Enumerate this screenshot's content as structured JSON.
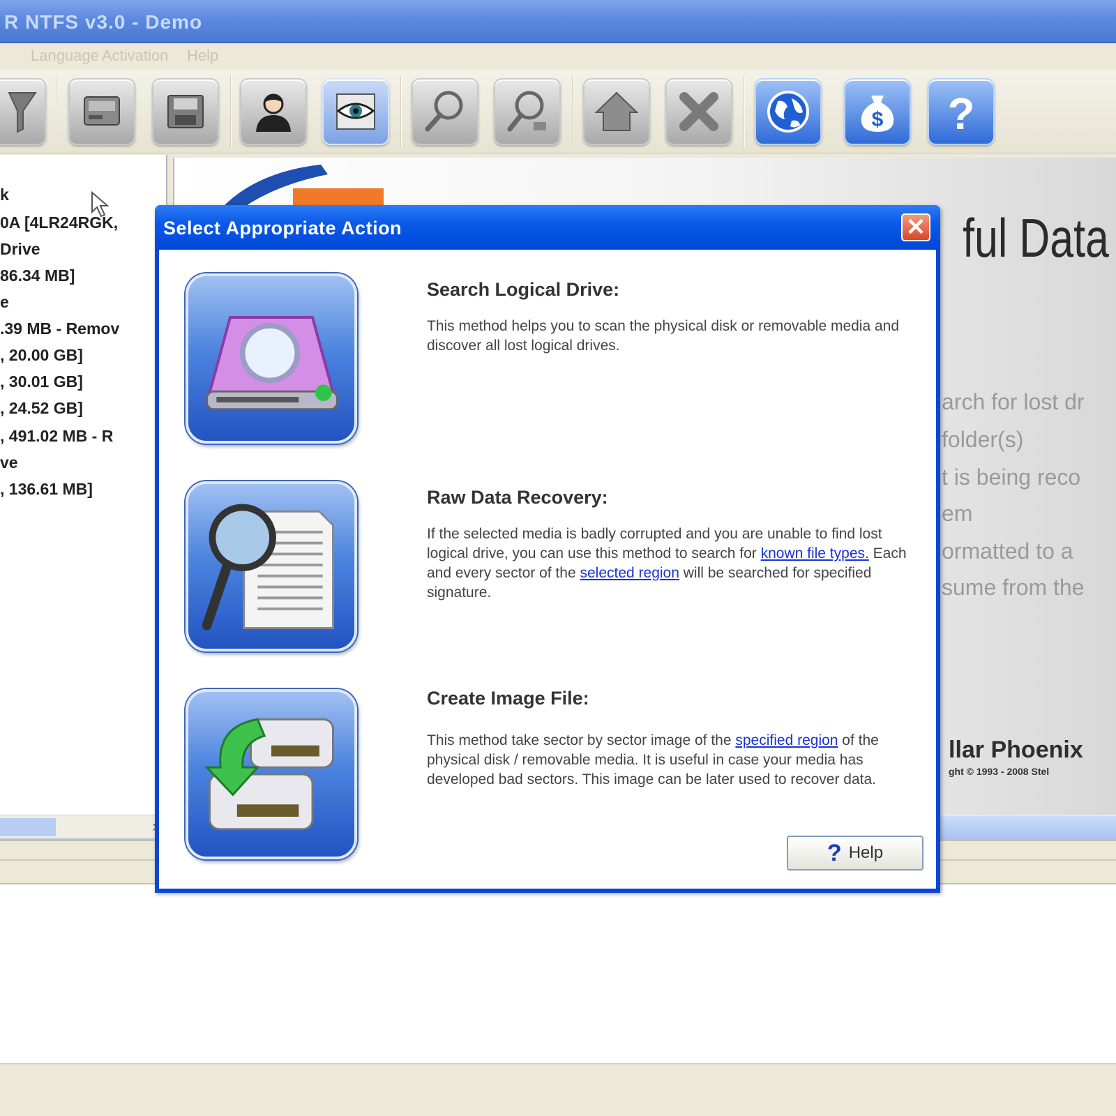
{
  "window": {
    "title": "R NTFS v3.0 - Demo"
  },
  "menu": {
    "items": [
      "Language",
      "Activation",
      "Help"
    ]
  },
  "toolbar": {
    "buttons": [
      {
        "name": "filter-icon",
        "style": "gray"
      },
      {
        "name": "drive-icon",
        "style": "gray"
      },
      {
        "name": "save-disk-icon",
        "style": "gray"
      },
      {
        "name": "user-icon",
        "style": "gray"
      },
      {
        "name": "preview-eye-icon",
        "style": "blue-tint"
      },
      {
        "name": "search-icon",
        "style": "gray"
      },
      {
        "name": "advanced-search-icon",
        "style": "gray"
      },
      {
        "name": "home-icon",
        "style": "gray"
      },
      {
        "name": "stop-icon",
        "style": "gray"
      },
      {
        "name": "globe-icon",
        "style": "blue"
      },
      {
        "name": "money-bag-icon",
        "style": "blue"
      },
      {
        "name": "help-icon",
        "style": "blue"
      }
    ]
  },
  "tree": {
    "items": [
      "k",
      "0A [4LR24RGK,",
      "Drive",
      "86.34 MB]",
      "e",
      ".39 MB - Remov",
      ", 20.00 GB]",
      ", 30.01 GB]",
      ", 24.52 GB]",
      ", 491.02 MB - R",
      "ve",
      ", 136.61 MB]"
    ]
  },
  "background": {
    "heading": "ful Data",
    "lines": [
      "arch for lost dr",
      "folder(s)",
      "t is being reco",
      "em",
      "ormatted to a",
      "sume from the"
    ],
    "brand": "llar Phoenix",
    "copyright": "ght © 1993 - 2008 Stel"
  },
  "dialog": {
    "title": "Select Appropriate Action",
    "close_symbol": "✕",
    "actions": [
      {
        "icon": "search-drive-icon",
        "title": "Search Logical Drive:",
        "desc_parts": [
          "This method helps you to scan the physical disk or removable media and discover all lost logical drives."
        ]
      },
      {
        "icon": "raw-recovery-icon",
        "title": "Raw Data Recovery:",
        "desc_parts": [
          "If the selected media is badly corrupted and you are unable to find lost logical drive, you can use this method to search for ",
          "known file types.",
          " Each and every sector of the ",
          "selected region",
          " will be searched for specified signature."
        ]
      },
      {
        "icon": "create-image-icon",
        "title": "Create Image File:",
        "desc_parts": [
          "This method take sector by sector image of the ",
          "specified region",
          " of the physical disk / removable media. It is useful in case your media has developed bad sectors. This image can be later used to recover data."
        ]
      }
    ],
    "help_button": {
      "symbol": "?",
      "label": "Help"
    }
  },
  "colors": {
    "dialog_border": "#0a47d6",
    "link": "#1a33d6",
    "close_button": "#d8452a"
  }
}
